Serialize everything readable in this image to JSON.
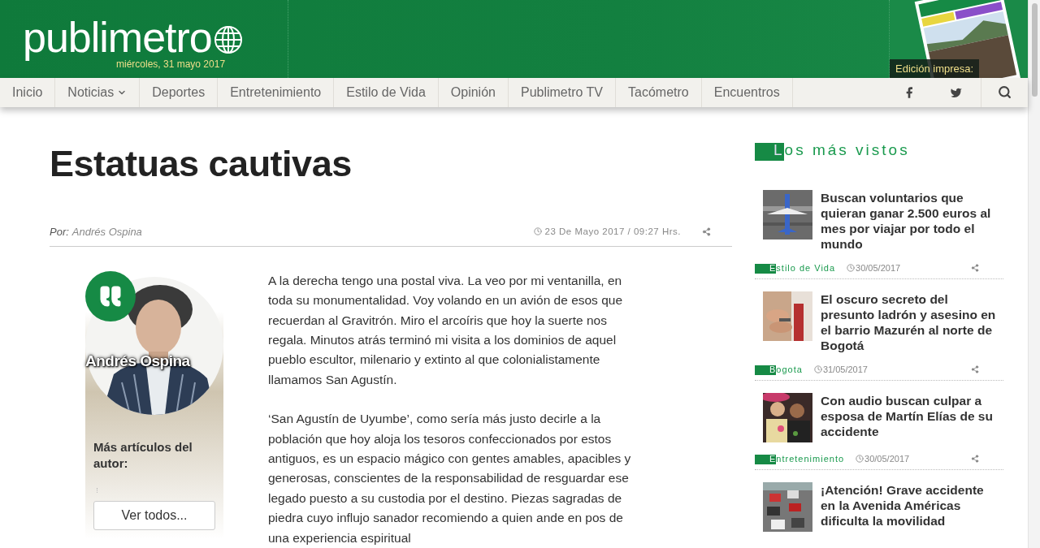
{
  "header": {
    "logo": "publimetro",
    "date": "miércoles, 31 mayo 2017",
    "print_edition": {
      "label": "Edición impresa:",
      "kind": "picture"
    }
  },
  "nav": {
    "items": [
      {
        "label": "Inicio",
        "selected": false,
        "has_menu": false
      },
      {
        "label": "Noticias",
        "selected": false,
        "has_menu": true
      },
      {
        "label": "Deportes",
        "selected": false,
        "has_menu": false
      },
      {
        "label": "Entretenimiento",
        "selected": false,
        "has_menu": false
      },
      {
        "label": "Estilo de Vida",
        "selected": false,
        "has_menu": false
      },
      {
        "label": "Opinión",
        "selected": false,
        "has_menu": false
      },
      {
        "label": "Publimetro TV",
        "selected": false,
        "has_menu": false
      },
      {
        "label": "Tacómetro",
        "selected": false,
        "has_menu": false
      },
      {
        "label": "Encuentros",
        "selected": false,
        "has_menu": false
      }
    ]
  },
  "article": {
    "title": "Estatuas cautivas",
    "byline_prefix": "Por:",
    "author": "Andrés Ospina",
    "date": "23 De Mayo 2017 / 09:27 Hrs.",
    "author_card": {
      "name": "Andrés Ospina",
      "more_label": "Más artículos del autor:",
      "button": "Ver todos..."
    },
    "paragraphs": [
      "A la derecha tengo una postal viva. La veo por mi ventanilla, en toda su monumentalidad. Voy volando en un avión de esos que recuerdan al Gravitrón. Miro el arcoíris que hoy la suerte nos regala. Minutos atrás terminó mi visita a los dominios de aquel pueblo escultor, milenario y extinto al que colonialistamente llamamos San Agustín.",
      "‘San Agustín de Uyumbe’, como sería más justo decirle a la población que hoy aloja los tesoros confeccionados por estos antiguos, es un espacio mágico con gentes amables, apacibles y generosas, conscientes de la responsabilidad de resguardar ese legado puesto a su custodia por el destino. Piezas sagradas de piedra cuyo influjo sanador recomiendo a quien ande en pos de una experiencia espiritual"
    ]
  },
  "sidebar": {
    "heading": "Los más vistos",
    "items": [
      {
        "title": "Buscan voluntarios que quieran ganar 2.500 euros al mes por viajar por todo el mundo",
        "category": "Estilo de Vida",
        "date": "30/05/2017",
        "kind": "picture"
      },
      {
        "title": "El oscuro secreto del presunto ladrón y asesino en el barrio Mazurén al norte de Bogotá",
        "category": "Bogota",
        "date": "31/05/2017",
        "kind": "picture"
      },
      {
        "title": "Con audio buscan culpar a esposa de Martín Elías de su accidente",
        "category": "Entretenimiento",
        "date": "30/05/2017",
        "kind": "picture"
      },
      {
        "title": "¡Atención! Grave accidente en la Avenida Américas dificulta la movilidad",
        "kind": "picture"
      }
    ]
  }
}
